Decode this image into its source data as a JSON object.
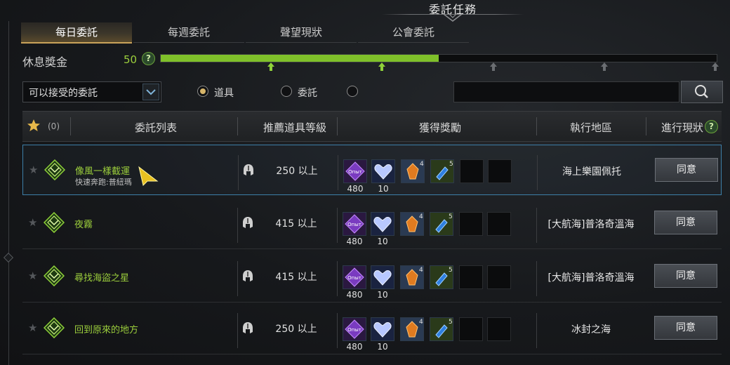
{
  "window": {
    "title": "委託任務"
  },
  "tabs": [
    {
      "label": "每日委託",
      "active": true
    },
    {
      "label": "每週委託",
      "active": false
    },
    {
      "label": "聲望現狀",
      "active": false
    },
    {
      "label": "公會委託",
      "active": false
    }
  ],
  "rest_bonus": {
    "label": "休息獎金",
    "value": "50",
    "progress_fraction": 0.5,
    "help": "?"
  },
  "filter": {
    "dropdown_value": "可以接受的委託",
    "radios": [
      {
        "label": "道具",
        "selected": true
      },
      {
        "label": "委託",
        "selected": false
      },
      {
        "label": "",
        "selected": false
      }
    ],
    "search_placeholder": ""
  },
  "table": {
    "favorite_count": "(0)",
    "headers": {
      "quest_list": "委託列表",
      "recommended_level": "推薦道具等級",
      "rewards": "獲得獎勵",
      "region": "執行地區",
      "progress": "進行現狀",
      "progress_help": "?"
    },
    "rows": [
      {
        "name": "像風一樣截運",
        "subtitle": "快速奔跑:普紐瑪",
        "level": "250 以上",
        "reward_counts": [
          "480",
          "10"
        ],
        "reward_sup": [
          "4",
          "5"
        ],
        "region": "海上樂園佩托",
        "button": "同意",
        "selected": true
      },
      {
        "name": "夜霧",
        "subtitle": "",
        "level": "415 以上",
        "reward_counts": [
          "480",
          "10"
        ],
        "reward_sup": [
          "4",
          "5"
        ],
        "region": "[大航海]普洛奇溫海",
        "button": "同意",
        "selected": false
      },
      {
        "name": "尋找海盜之星",
        "subtitle": "",
        "level": "415 以上",
        "reward_counts": [
          "480",
          "10"
        ],
        "reward_sup": [
          "4",
          "5"
        ],
        "region": "[大航海]普洛奇溫海",
        "button": "同意",
        "selected": false
      },
      {
        "name": "回到原來的地方",
        "subtitle": "",
        "level": "250 以上",
        "reward_counts": [
          "480",
          "10"
        ],
        "reward_sup": [
          "4",
          "5"
        ],
        "region": "冰封之海",
        "button": "同意",
        "selected": false
      }
    ]
  },
  "icons": {
    "exp": "exp-gem-icon",
    "crystal": "crystal-heart-icon",
    "stone": "orange-stone-icon",
    "potion": "blue-potion-icon",
    "rank": "green-rank-emblem-icon",
    "helmet": "helmet-icon",
    "star": "star-icon",
    "search": "search-icon"
  },
  "colors": {
    "accent_green": "#9ccf3c",
    "tab_gold": "#c9a35a",
    "selected_border": "#3d7fa8"
  }
}
